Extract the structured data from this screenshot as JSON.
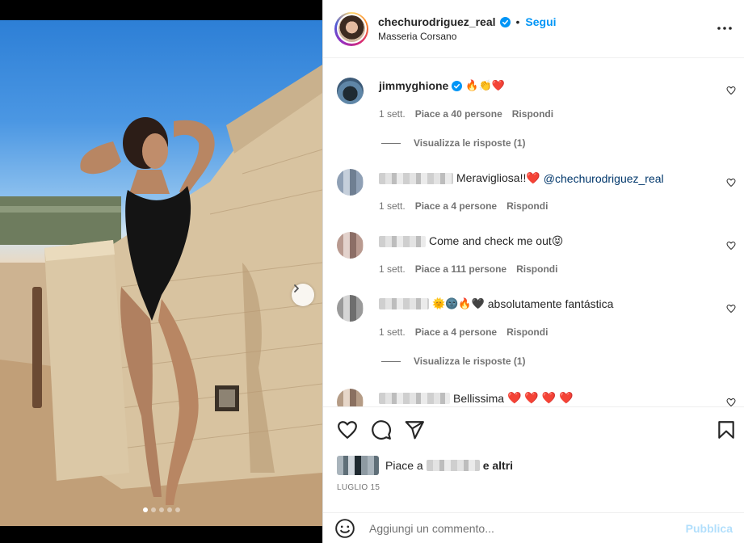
{
  "post": {
    "username": "chechurodriguez_real",
    "follow_label": "Segui",
    "separator": "•",
    "location": "Masseria Corsano",
    "carousel_dots": 5,
    "carousel_active": 0
  },
  "comments": [
    {
      "username": "jimmyghione",
      "verified": true,
      "text": "🔥👏❤️",
      "time": "1 sett.",
      "likes": "Piace a 40 persone",
      "reply": "Rispondi",
      "view_replies": "Visualizza le risposte (1)"
    },
    {
      "username_hidden": true,
      "text": "Meravigliosa!!❤️",
      "mention": "@chechurodriguez_real",
      "time": "1 sett.",
      "likes": "Piace a 4 persone",
      "reply": "Rispondi"
    },
    {
      "username_hidden": true,
      "text": "Come and check me out😝",
      "time": "1 sett.",
      "likes": "Piace a 111 persone",
      "reply": "Rispondi"
    },
    {
      "username_hidden": true,
      "emojis": "🌞🌚🔥🖤",
      "text": "absolutamente fantástica",
      "time": "1 sett.",
      "likes": "Piace a 4 persone",
      "reply": "Rispondi",
      "view_replies": "Visualizza le risposte (1)"
    },
    {
      "username_hidden": true,
      "text": "Bellissima",
      "hearts": "❤️ ❤️ ❤️ ❤️"
    }
  ],
  "likes": {
    "prefix": "Piace a",
    "suffix": "e altri"
  },
  "date": "LUGLIO 15",
  "add_comment": {
    "placeholder": "Aggiungi un commento...",
    "publish_label": "Pubblica"
  },
  "colors": {
    "accent": "#0095f6",
    "publish_disabled": "#b2dffc",
    "secondary_text": "#737373"
  }
}
